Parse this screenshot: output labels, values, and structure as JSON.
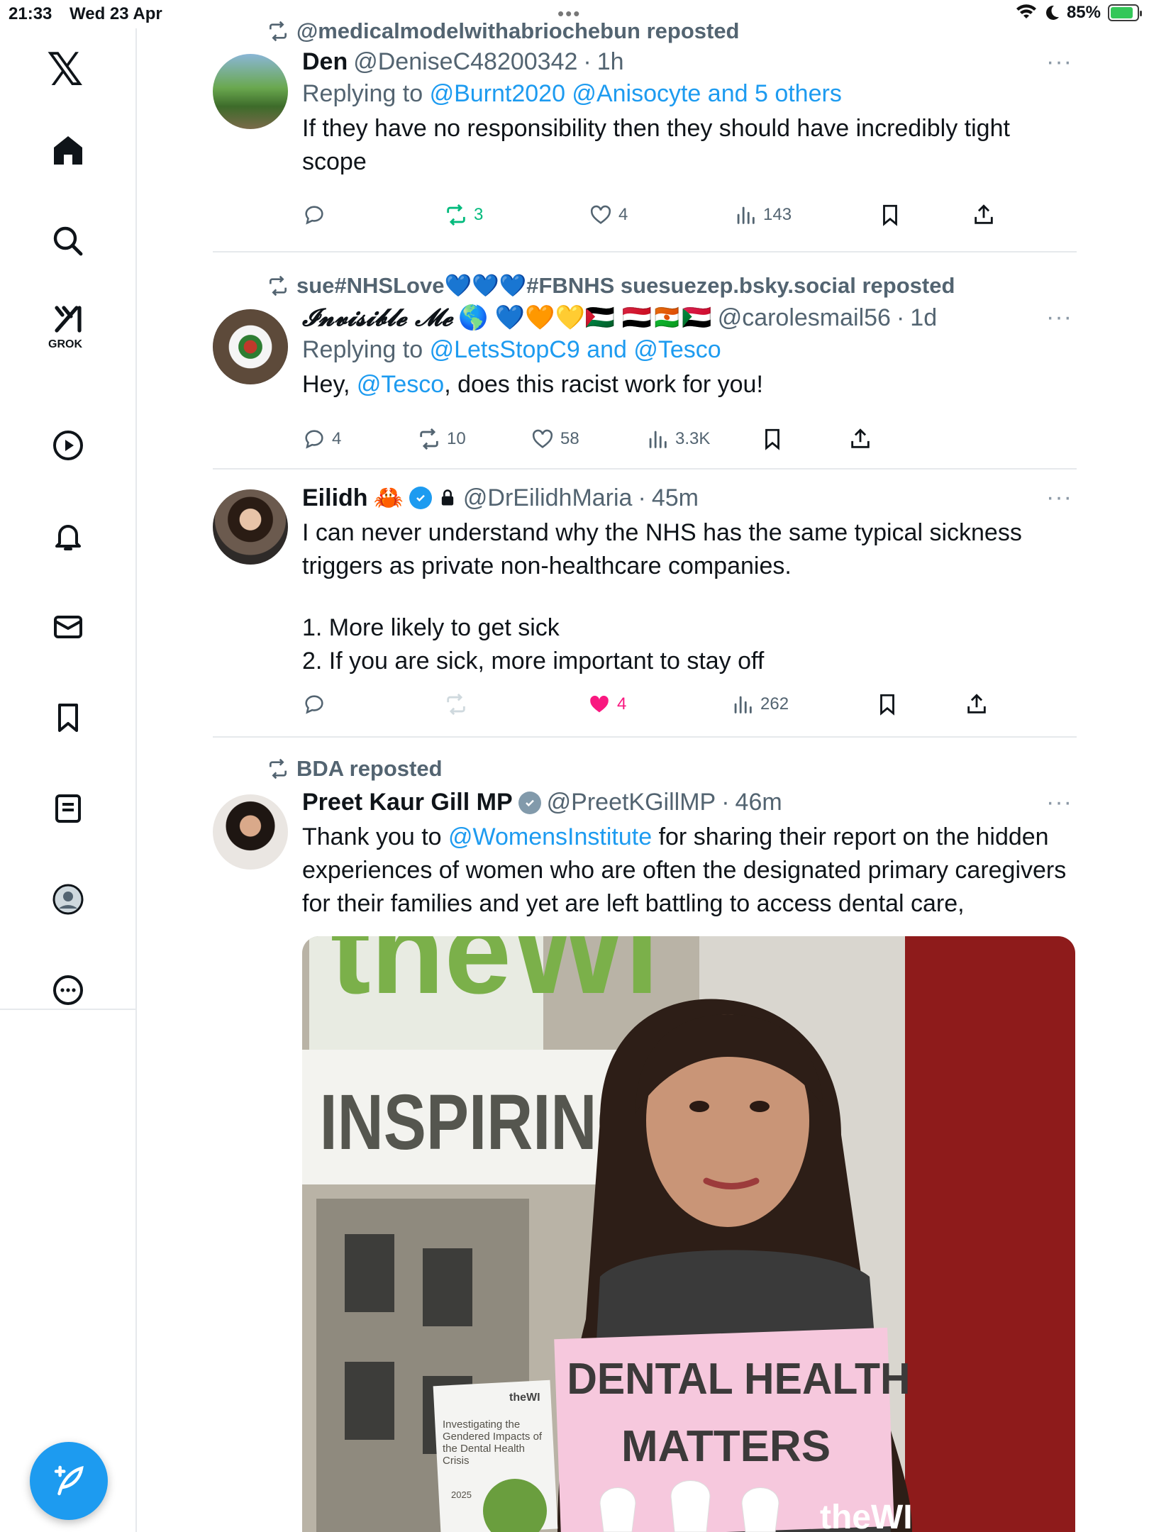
{
  "status_bar": {
    "time": "21:33",
    "date": "Wed 23 Apr",
    "battery": "85%",
    "battery_level": 0.85
  },
  "sidebar": {
    "logo": "𝕏",
    "items": [
      {
        "name": "home",
        "icon": "home-icon"
      },
      {
        "name": "search",
        "icon": "search-icon"
      },
      {
        "name": "grok",
        "icon": "grok-icon",
        "label": "GROK"
      },
      {
        "name": "video",
        "icon": "play-icon"
      },
      {
        "name": "notifications",
        "icon": "bell-icon"
      },
      {
        "name": "messages",
        "icon": "mail-icon"
      },
      {
        "name": "bookmarks",
        "icon": "bookmark-icon"
      },
      {
        "name": "lists",
        "icon": "list-icon"
      },
      {
        "name": "profile",
        "icon": "profile-icon"
      },
      {
        "name": "more",
        "icon": "more-circle-icon"
      }
    ],
    "compose_icon": "compose-feather-icon"
  },
  "tweets": [
    {
      "repost_by": "@medicalmodelwithabriochebun reposted",
      "name": "Den",
      "handle": "@DeniseC48200342",
      "time": "1h",
      "reply_prefix": "Replying to",
      "reply_to": "@Burnt2020 @Anisocyte and 5 others",
      "text": "If they have no responsibility then they should have incredibly tight scope",
      "replies": "",
      "reposts": "3",
      "likes": "4",
      "views": "143"
    },
    {
      "repost_by": "sue#NHSLove💙💙💙#FBNHS suesuezep.bsky.social reposted",
      "name": "𝓘𝓷𝓿𝓲𝓼𝓲𝓫𝓵𝓮 𝓜𝓮",
      "name_emoji": "🌎 💙🧡💛🇵🇸 🇾🇪🇳🇪🇸🇩",
      "handle": "@carolesmail56",
      "time": "1d",
      "reply_prefix": "Replying to",
      "reply_to": "@LetsStopC9 and @Tesco",
      "text_before": "Hey, ",
      "text_mention": "@Tesco",
      "text_after": ", does this racist work for you!",
      "replies": "4",
      "reposts": "10",
      "likes": "58",
      "views": "3.3K"
    },
    {
      "name": "Eilidh",
      "name_emoji": "🦀",
      "handle": "@DrEilidhMaria",
      "time": "45m",
      "text_lines": [
        "I can never understand why the NHS has the same typical sickness triggers as private non-healthcare companies.",
        "",
        "1. More likely to get sick",
        "2. If you are sick, more important to stay off"
      ],
      "replies": "",
      "reposts": "",
      "likes": "4",
      "views": "262"
    },
    {
      "repost_by": "BDA reposted",
      "name": "Preet Kaur Gill MP",
      "handle": "@PreetKGillMP",
      "time": "46m",
      "text_before": "Thank you to ",
      "text_mention": "@WomensInstitute",
      "text_after": " for sharing their report on the hidden experiences of women who are often the designated primary caregivers for their families and yet are left battling to access dental care,",
      "media": {
        "banner_top": "theWI",
        "banner_text": "INSPIRING W",
        "report_brand": "theWI",
        "report_title": "Investigating the Gendered Impacts of the Dental Health Crisis",
        "report_year": "2025",
        "sign_text_1": "DENTAL HEALTH",
        "sign_text_2": "MATTERS",
        "sign_brand": "theWI"
      }
    }
  ],
  "separator": "·",
  "colors": {
    "accent": "#1d9bf0",
    "repost_green": "#00ba7c",
    "like_pink": "#f91880",
    "muted": "#536471"
  }
}
